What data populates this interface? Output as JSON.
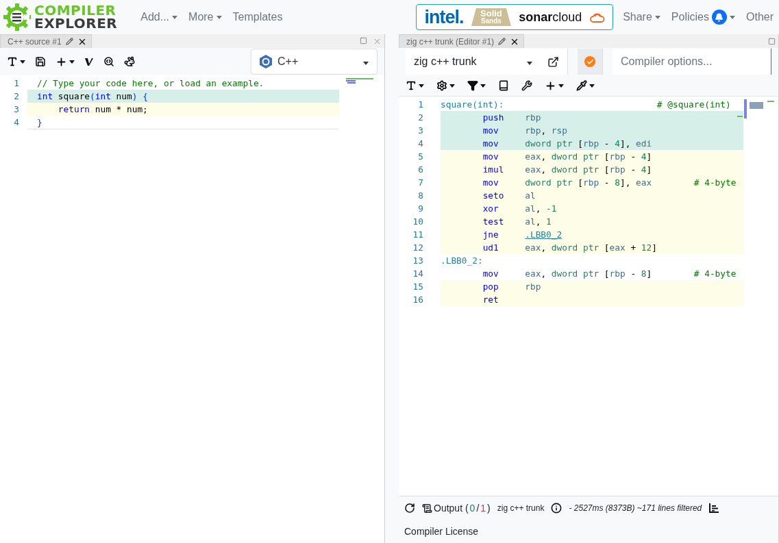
{
  "nav": {
    "logo": {
      "line1": "COMPILER",
      "line2": "EXPLORER"
    },
    "menus": [
      {
        "label": "Add...",
        "dropdown": true
      },
      {
        "label": "More",
        "dropdown": true
      },
      {
        "label": "Templates",
        "dropdown": false
      }
    ],
    "sponsors": {
      "intel": "intel.",
      "solid": "Solid",
      "sands": "Sands",
      "sonar": "**sonar**cloud"
    },
    "right_menus": [
      {
        "label": "Share",
        "dropdown": true,
        "bell": false
      },
      {
        "label": "Policies",
        "dropdown": true,
        "bell": true
      },
      {
        "label": "Other",
        "dropdown": false,
        "bell": false
      }
    ]
  },
  "editor": {
    "tab": "C++ source #1",
    "language": "C++",
    "lines": [
      {
        "num": "1",
        "kind": "plain",
        "indent": false,
        "tokens": [
          {
            "text": "// Type your code here, or load an example.",
            "kind": "comment"
          }
        ]
      },
      {
        "num": "2",
        "kind": "teal",
        "indent": false,
        "tokens": [
          {
            "text": "int",
            "kind": "keyword"
          },
          {
            "text": " square",
            "kind": "plain"
          },
          {
            "text": "(",
            "kind": "bracket"
          },
          {
            "text": "int",
            "kind": "keyword"
          },
          {
            "text": " num",
            "kind": "plain"
          },
          {
            "text": ")",
            "kind": "bracket"
          },
          {
            "text": " {",
            "kind": "bracket"
          }
        ]
      },
      {
        "num": "3",
        "kind": "yellow",
        "indent": true,
        "tokens": [
          {
            "text": "return",
            "kind": "keyword"
          },
          {
            "text": " num * num;",
            "kind": "plain"
          }
        ]
      },
      {
        "num": "4",
        "kind": "plain",
        "indent": false,
        "tokens": [
          {
            "text": "}",
            "kind": "bracket"
          }
        ]
      }
    ]
  },
  "compiler": {
    "tab": "zig c++ trunk (Editor #1)",
    "name": "zig c++ trunk",
    "options_placeholder": "Compiler options...",
    "ok": true,
    "lines": [
      {
        "num": "1",
        "kind": "plain",
        "label": "square(int):",
        "comment": "# @square(int)"
      },
      {
        "num": "2",
        "kind": "teal",
        "op": "push",
        "args": [
          {
            "text": "rbp",
            "kind": "reg"
          }
        ]
      },
      {
        "num": "3",
        "kind": "teal",
        "op": "mov",
        "args": [
          {
            "text": "rbp",
            "kind": "reg"
          },
          {
            "text": ", ",
            "kind": "punct"
          },
          {
            "text": "rsp",
            "kind": "reg"
          }
        ]
      },
      {
        "num": "4",
        "kind": "teal",
        "op": "mov",
        "args": [
          {
            "text": "dword ptr",
            "kind": "size"
          },
          {
            "text": " [",
            "kind": "punct"
          },
          {
            "text": "rbp",
            "kind": "reg"
          },
          {
            "text": " - ",
            "kind": "punct"
          },
          {
            "text": "4",
            "kind": "number"
          },
          {
            "text": "], ",
            "kind": "punct"
          },
          {
            "text": "edi",
            "kind": "reg"
          }
        ]
      },
      {
        "num": "5",
        "kind": "yellow",
        "op": "mov",
        "args": [
          {
            "text": "eax",
            "kind": "reg"
          },
          {
            "text": ", ",
            "kind": "punct"
          },
          {
            "text": "dword ptr",
            "kind": "size"
          },
          {
            "text": " [",
            "kind": "punct"
          },
          {
            "text": "rbp",
            "kind": "reg"
          },
          {
            "text": " - ",
            "kind": "punct"
          },
          {
            "text": "4",
            "kind": "number"
          },
          {
            "text": "]",
            "kind": "punct"
          }
        ]
      },
      {
        "num": "6",
        "kind": "yellow",
        "op": "imul",
        "args": [
          {
            "text": "eax",
            "kind": "reg"
          },
          {
            "text": ", ",
            "kind": "punct"
          },
          {
            "text": "dword ptr",
            "kind": "size"
          },
          {
            "text": " [",
            "kind": "punct"
          },
          {
            "text": "rbp",
            "kind": "reg"
          },
          {
            "text": " - ",
            "kind": "punct"
          },
          {
            "text": "4",
            "kind": "number"
          },
          {
            "text": "]",
            "kind": "punct"
          }
        ]
      },
      {
        "num": "7",
        "kind": "yellow",
        "op": "mov",
        "args": [
          {
            "text": "dword ptr",
            "kind": "size"
          },
          {
            "text": " [",
            "kind": "punct"
          },
          {
            "text": "rbp",
            "kind": "reg"
          },
          {
            "text": " - ",
            "kind": "punct"
          },
          {
            "text": "8",
            "kind": "number"
          },
          {
            "text": "], ",
            "kind": "punct"
          },
          {
            "text": "eax",
            "kind": "reg"
          }
        ],
        "comment": "# 4-byte"
      },
      {
        "num": "8",
        "kind": "yellow",
        "op": "seto",
        "args": [
          {
            "text": "al",
            "kind": "reg"
          }
        ]
      },
      {
        "num": "9",
        "kind": "yellow",
        "op": "xor",
        "args": [
          {
            "text": "al",
            "kind": "reg"
          },
          {
            "text": ", ",
            "kind": "punct"
          },
          {
            "text": "-1",
            "kind": "number"
          }
        ]
      },
      {
        "num": "10",
        "kind": "yellow",
        "op": "test",
        "args": [
          {
            "text": "al",
            "kind": "reg"
          },
          {
            "text": ", ",
            "kind": "punct"
          },
          {
            "text": "1",
            "kind": "number"
          }
        ]
      },
      {
        "num": "11",
        "kind": "yellow",
        "op": "jne",
        "args": [
          {
            "text": ".LBB0_2",
            "kind": "link"
          }
        ]
      },
      {
        "num": "12",
        "kind": "yellow",
        "op": "ud1",
        "args": [
          {
            "text": "eax",
            "kind": "reg"
          },
          {
            "text": ", ",
            "kind": "punct"
          },
          {
            "text": "dword ptr",
            "kind": "size"
          },
          {
            "text": " [",
            "kind": "punct"
          },
          {
            "text": "eax",
            "kind": "reg"
          },
          {
            "text": " + ",
            "kind": "punct"
          },
          {
            "text": "12",
            "kind": "number"
          },
          {
            "text": "]",
            "kind": "punct"
          }
        ]
      },
      {
        "num": "13",
        "kind": "plain",
        "label": ".LBB0_2:"
      },
      {
        "num": "14",
        "kind": "plain",
        "op": "mov",
        "args": [
          {
            "text": "eax",
            "kind": "reg"
          },
          {
            "text": ", ",
            "kind": "punct"
          },
          {
            "text": "dword ptr",
            "kind": "size"
          },
          {
            "text": " [",
            "kind": "punct"
          },
          {
            "text": "rbp",
            "kind": "reg"
          },
          {
            "text": " - ",
            "kind": "punct"
          },
          {
            "text": "8",
            "kind": "number"
          },
          {
            "text": "]",
            "kind": "punct"
          }
        ],
        "comment": "# 4-byte"
      },
      {
        "num": "15",
        "kind": "yellow",
        "op": "pop",
        "args": [
          {
            "text": "rbp",
            "kind": "reg"
          }
        ]
      },
      {
        "num": "16",
        "kind": "yellow",
        "op": "ret"
      }
    ],
    "status": {
      "output": "Output",
      "open": "(",
      "ok_count": "0",
      "slash": "/",
      "total": "1",
      "close": ")",
      "compiler": "zig c++ trunk",
      "timing": "- 2527ms (8373B) ~171 lines filtered",
      "license": "Compiler License"
    }
  }
}
